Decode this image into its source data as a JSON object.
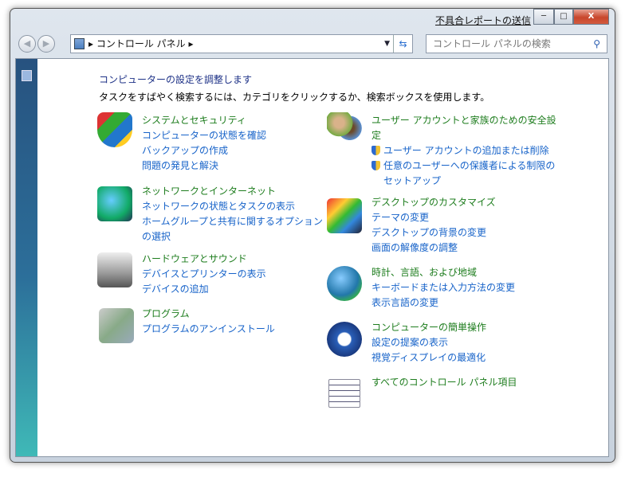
{
  "window": {
    "report_link": "不具合レポートの送信",
    "minimize": "─",
    "maximize": "□",
    "close": "X"
  },
  "address": {
    "breadcrumb": "▸ コントロール パネル ▸",
    "search_placeholder": "コントロール パネルの検索"
  },
  "main": {
    "title": "コンピューターの設定を調整します",
    "subtitle": "タスクをすばやく検索するには、カテゴリをクリックするか、検索ボックスを使用します。",
    "categories": [
      {
        "heading": "システムとセキュリティ",
        "links": [
          "コンピューターの状態を確認",
          "バックアップの作成",
          "問題の発見と解決"
        ],
        "icon": "shield-icon"
      },
      {
        "heading": "ネットワークとインターネット",
        "links": [
          "ネットワークの状態とタスクの表示",
          "ホームグループと共有に関するオプション",
          "の選択"
        ],
        "icon": "network-icon"
      },
      {
        "heading": "ハードウェアとサウンド",
        "links": [
          "デバイスとプリンターの表示",
          "デバイスの追加"
        ],
        "icon": "printer-icon"
      },
      {
        "heading": "プログラム",
        "links": [
          "プログラムのアンインストール"
        ],
        "icon": "programs-icon"
      },
      {
        "heading": "ユーザー アカウントと家族のための安全設",
        "heading2": "定",
        "links": [
          "ユーザー アカウントの追加または削除",
          "任意のユーザーへの保護者による制限の",
          "セットアップ"
        ],
        "icon": "users-icon"
      },
      {
        "heading": "デスクトップのカスタマイズ",
        "links": [
          "テーマの変更",
          "デスクトップの背景の変更",
          "画面の解像度の調整"
        ],
        "icon": "desktop-icon"
      },
      {
        "heading": "時計、言語、および地域",
        "links": [
          "キーボードまたは入力方法の変更",
          "表示言語の変更"
        ],
        "icon": "clock-globe-icon"
      },
      {
        "heading": "コンピューターの簡単操作",
        "links": [
          "設定の提案の表示",
          "視覚ディスプレイの最適化"
        ],
        "icon": "ease-of-access-icon"
      },
      {
        "heading": "すべてのコントロール パネル項目",
        "links": [],
        "icon": "checklist-icon"
      }
    ]
  }
}
